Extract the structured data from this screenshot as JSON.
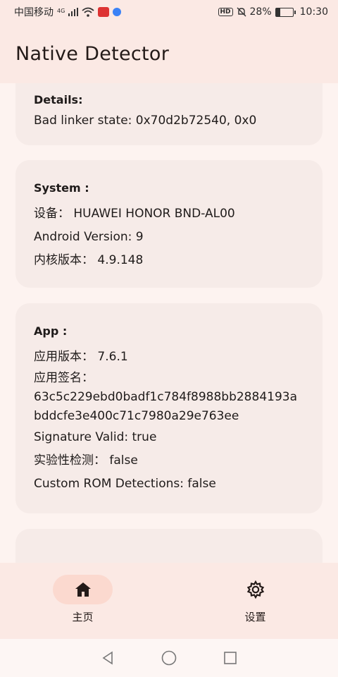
{
  "status_bar": {
    "carrier": "中国移动",
    "network": "4G",
    "battery": "28%",
    "time": "10:30",
    "hd": "HD"
  },
  "app_bar": {
    "title": "Native Detector"
  },
  "details_card": {
    "title": "Details:",
    "lines": [
      "Bad linker state: 0x70d2b72540, 0x0"
    ]
  },
  "system_card": {
    "title": "System :",
    "lines": [
      "设备： HUAWEI HONOR BND-AL00",
      "Android Version: 9",
      "内核版本： 4.9.148"
    ]
  },
  "app_card": {
    "title": "App :",
    "version": "应用版本： 7.6.1",
    "signature_label": "应用签名：",
    "signature_value": "63c5c229ebd0badf1c784f8988bb2884193abddcfe3e400c71c7980a29e763ee",
    "signature_valid": "Signature Valid: true",
    "experimental": "实验性检测： false",
    "custom_rom": "Custom ROM Detections: false"
  },
  "bottom_nav": {
    "items": [
      {
        "label": "主页",
        "icon": "home-icon",
        "selected": true
      },
      {
        "label": "设置",
        "icon": "settings-icon",
        "selected": false
      }
    ]
  },
  "system_nav": {
    "icons": [
      "back-icon",
      "home-circle-icon",
      "recents-icon"
    ]
  },
  "colors": {
    "surface": "#fdf3f0",
    "bar": "#fbe9e4",
    "card": "#f6ebe8",
    "pill": "#fbd9cf"
  }
}
